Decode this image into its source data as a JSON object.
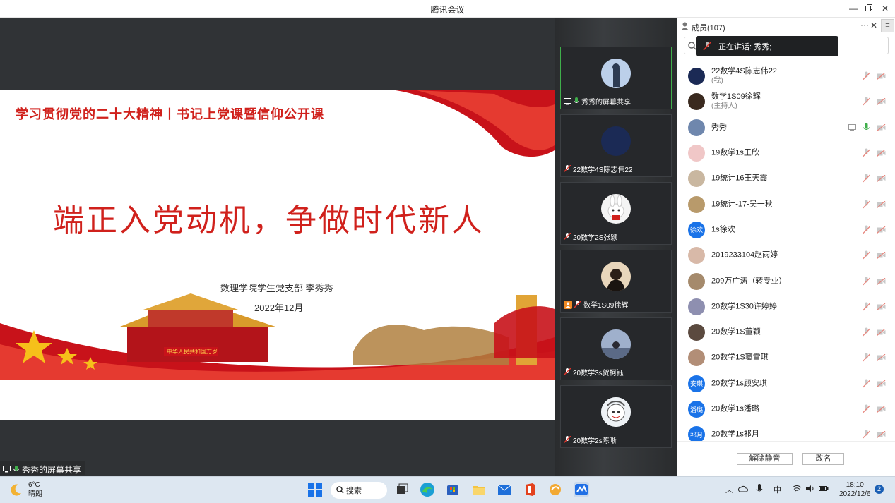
{
  "window": {
    "title": "腾讯会议"
  },
  "stage": {
    "slide": {
      "banner": "学习贯彻党的二十大精神丨书记上党课暨信仰公开课",
      "headline": "端正入党动机，争做时代新人",
      "org": "数理学院学生党支部  李秀秀",
      "date": "2022年12月",
      "gate_sign": "中华人民共和国万岁"
    },
    "share_label": "秀秀的屏幕共享"
  },
  "tiles": [
    {
      "label": "秀秀的屏幕共享",
      "active": true,
      "color": "#8aa4c8"
    },
    {
      "label": "22数学4S陈志伟22",
      "active": false,
      "color": "#1b2a55"
    },
    {
      "label": "20数学2S张颖",
      "active": false,
      "color": "#f4f4f4"
    },
    {
      "label": "数学1S09徐辉",
      "active": false,
      "color": "#3a2a1f"
    },
    {
      "label": "20数学3s贺柯钰",
      "active": false,
      "color": "#7b8fb0"
    },
    {
      "label": "20数学2s陈晰",
      "active": false,
      "color": "#e8eef5"
    }
  ],
  "panel": {
    "title": "成员(107)",
    "speaking": "正在讲话: 秀秀;",
    "members": [
      {
        "name": "22数学4S陈志伟22",
        "sub": "(我)",
        "avatar_color": "#1b2a55",
        "avatar_text": ""
      },
      {
        "name": "数学1S09徐辉",
        "sub": "(主持人)",
        "avatar_color": "#3a2a1f",
        "avatar_text": ""
      },
      {
        "name": "秀秀",
        "sub": "",
        "avatar_color": "#6f87ad",
        "avatar_text": "",
        "sharing": true,
        "mic_on": true
      },
      {
        "name": "19数学1s王欣",
        "sub": "",
        "avatar_color": "#f0c7c7",
        "avatar_text": ""
      },
      {
        "name": "19统计16王天霞",
        "sub": "",
        "avatar_color": "#c9b7a0",
        "avatar_text": ""
      },
      {
        "name": "19统计-17-吴一秋",
        "sub": "",
        "avatar_color": "#b89a6b",
        "avatar_text": ""
      },
      {
        "name": "1s徐欢",
        "sub": "",
        "avatar_color": "#1a73e8",
        "avatar_text": "徐欢"
      },
      {
        "name": "2019233104赵雨婷",
        "sub": "",
        "avatar_color": "#d8b9a8",
        "avatar_text": ""
      },
      {
        "name": "209万广涛（转专业）",
        "sub": "",
        "avatar_color": "#a58a6c",
        "avatar_text": ""
      },
      {
        "name": "20数学1S30许婷婷",
        "sub": "",
        "avatar_color": "#8e8fb0",
        "avatar_text": ""
      },
      {
        "name": "20数学1S董颖",
        "sub": "",
        "avatar_color": "#5b4a3f",
        "avatar_text": ""
      },
      {
        "name": "20数学1S窦雪琪",
        "sub": "",
        "avatar_color": "#b28e77",
        "avatar_text": ""
      },
      {
        "name": "20数学1s顾安琪",
        "sub": "",
        "avatar_color": "#1a73e8",
        "avatar_text": "安琪"
      },
      {
        "name": "20数学1s潘璐",
        "sub": "",
        "avatar_color": "#1a73e8",
        "avatar_text": "潘璐"
      },
      {
        "name": "20数学1s祁月",
        "sub": "",
        "avatar_color": "#1a73e8",
        "avatar_text": "祁月"
      }
    ],
    "buttons": {
      "unmute_all": "解除静音",
      "rename": "改名"
    }
  },
  "taskbar": {
    "weather": {
      "temp": "6°C",
      "condition": "晴朗"
    },
    "search_label": "搜索",
    "ime": "中",
    "time": "18:10",
    "date": "2022/12/6",
    "notifications": "2"
  },
  "colors": {
    "accent_red": "#d0211c",
    "active_green": "#3fae4b",
    "brand_blue": "#1a73e8"
  }
}
